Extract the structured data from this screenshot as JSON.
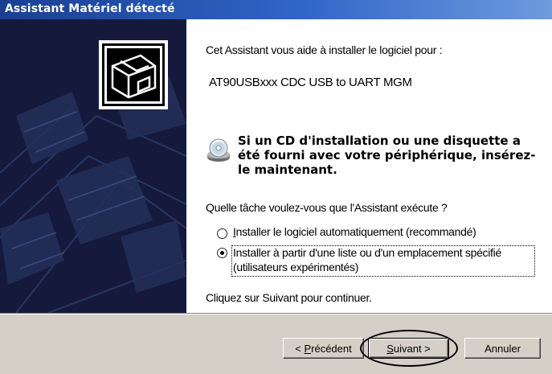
{
  "window": {
    "title": "Assistant Matériel détecté"
  },
  "intro": {
    "line1": "Cet Assistant vous aide à installer le logiciel pour :",
    "device": "AT90USBxxx CDC USB to UART MGM"
  },
  "cd_notice": {
    "icon": "cd-icon",
    "text": "Si un CD d'installation ou une disquette a été fourni avec votre périphérique, insérez-le maintenant."
  },
  "question": "Quelle tâche voulez-vous que l'Assistant exécute ?",
  "options": [
    {
      "label": "Installer le logiciel automatiquement (recommandé)",
      "selected": false
    },
    {
      "label": "Installer à partir d'une liste ou d'un emplacement spécifié",
      "label2": "(utilisateurs expérimentés)",
      "selected": true
    }
  ],
  "continue_text": "Cliquez sur Suivant pour continuer.",
  "buttons": {
    "back": {
      "pre": "< ",
      "accel": "P",
      "rest": "récédent"
    },
    "next": {
      "accel": "S",
      "rest": "uivant >"
    },
    "cancel": "Annuler"
  }
}
